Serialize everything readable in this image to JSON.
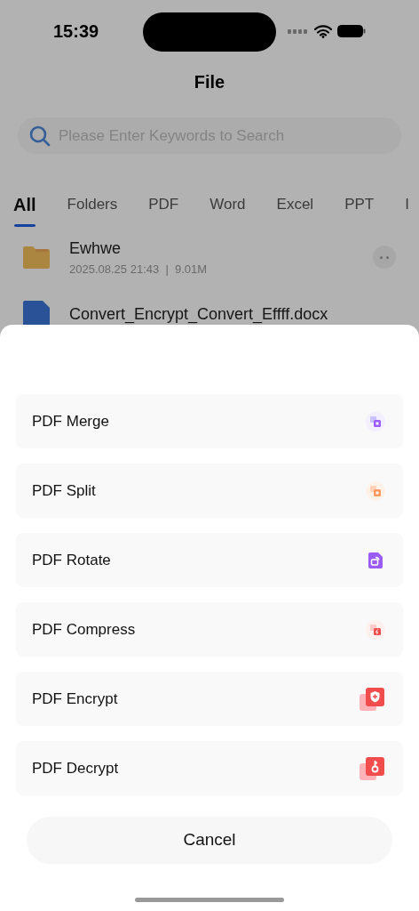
{
  "status_bar": {
    "time": "15:39"
  },
  "header": {
    "title": "File"
  },
  "search": {
    "placeholder": "Please Enter Keywords to Search"
  },
  "tabs": [
    {
      "label": "All",
      "selected": true
    },
    {
      "label": "Folders",
      "selected": false
    },
    {
      "label": "PDF",
      "selected": false
    },
    {
      "label": "Word",
      "selected": false
    },
    {
      "label": "Excel",
      "selected": false
    },
    {
      "label": "PPT",
      "selected": false
    },
    {
      "label": "I",
      "selected": false
    }
  ],
  "files": [
    {
      "kind": "folder",
      "name": "Ewhwe",
      "meta": "2025.08.25 21:43  |  9.01M"
    },
    {
      "kind": "doc",
      "name": "Convert_Encrypt_Convert_Effff.docx"
    }
  ],
  "action_sheet": {
    "actions": [
      {
        "label": "PDF Merge",
        "kind": "merge"
      },
      {
        "label": "PDF Split",
        "kind": "split"
      },
      {
        "label": "PDF Rotate",
        "kind": "rotate"
      },
      {
        "label": "PDF Compress",
        "kind": "compress"
      },
      {
        "label": "PDF Encrypt",
        "kind": "encrypt"
      },
      {
        "label": "PDF Decrypt",
        "kind": "decrypt"
      }
    ],
    "cancel": "Cancel"
  }
}
